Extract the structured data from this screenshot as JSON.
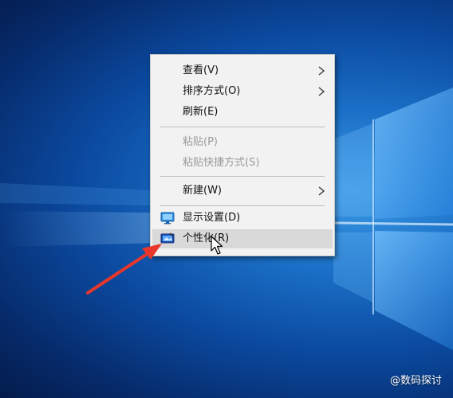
{
  "context_menu": {
    "items": [
      {
        "label": "查看(V)",
        "has_submenu": true,
        "enabled": true
      },
      {
        "label": "排序方式(O)",
        "has_submenu": true,
        "enabled": true
      },
      {
        "label": "刷新(E)",
        "has_submenu": false,
        "enabled": true
      },
      {
        "label": "粘贴(P)",
        "has_submenu": false,
        "enabled": false
      },
      {
        "label": "粘贴快捷方式(S)",
        "has_submenu": false,
        "enabled": false
      },
      {
        "label": "新建(W)",
        "has_submenu": true,
        "enabled": true
      },
      {
        "label": "显示设置(D)",
        "has_submenu": false,
        "enabled": true,
        "icon": "display-settings-icon"
      },
      {
        "label": "个性化(R)",
        "has_submenu": false,
        "enabled": true,
        "icon": "personalize-icon",
        "highlighted": true
      }
    ]
  },
  "annotation": {
    "arrow_color": "#e8372a"
  },
  "watermark": {
    "text": "@数码探讨"
  },
  "colors": {
    "menu_bg": "#f2f2f2",
    "hover_bg": "#d9d9d9",
    "disabled_text": "#9a9a9a",
    "desktop_blue": "#0b4aa0"
  }
}
